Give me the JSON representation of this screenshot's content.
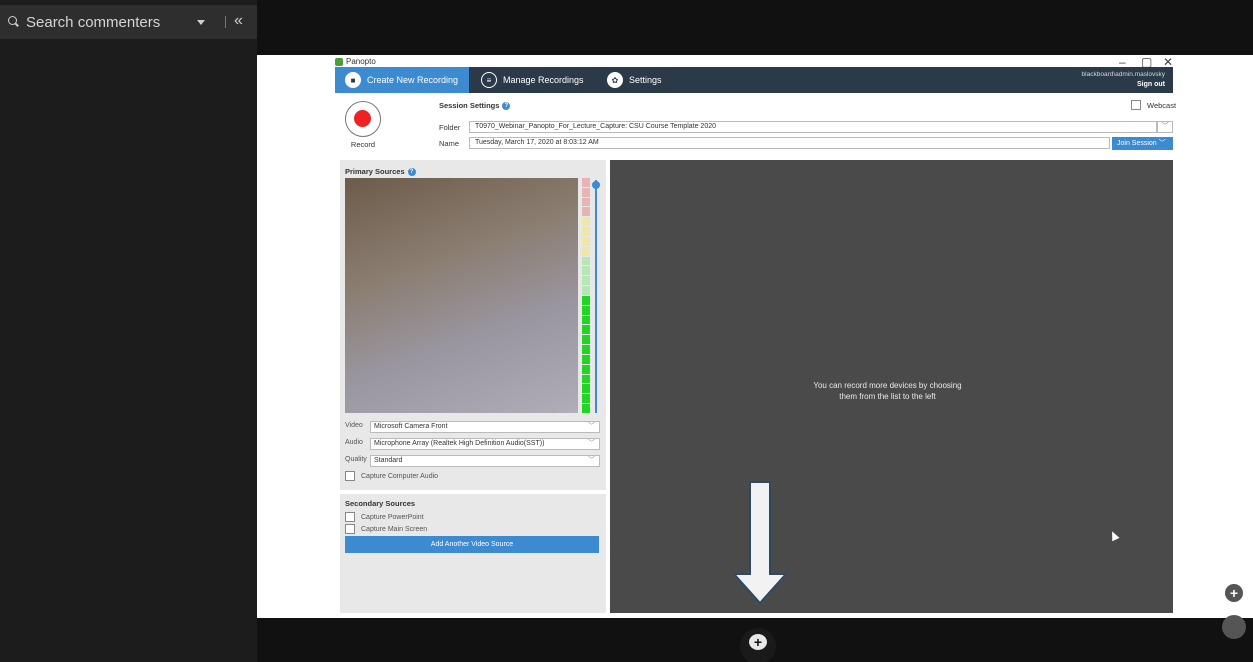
{
  "comments_panel": {
    "search_placeholder": "Search commenters",
    "collapse_symbol": "«"
  },
  "window": {
    "app_name": "Panopto",
    "controls": [
      "–",
      "▢",
      "✕"
    ]
  },
  "tabs": [
    {
      "label": "Create New Recording",
      "icon": "video-camera-icon",
      "active": true
    },
    {
      "label": "Manage Recordings",
      "icon": "list-icon",
      "active": false
    },
    {
      "label": "Settings",
      "icon": "gear-icon",
      "active": false
    }
  ],
  "user": {
    "name": "blackboard\\admin.maslovsky",
    "sign_out": "Sign out"
  },
  "record": {
    "label": "Record"
  },
  "session": {
    "title": "Session Settings",
    "help": "?",
    "webcast_label": "Webcast",
    "folder_label": "Folder",
    "folder_value": "T0970_Webinar_Panopto_For_Lecture_Capture: CSU Course Template 2020",
    "name_label": "Name",
    "name_value": "Tuesday, March 17, 2020 at 8:03:12 AM",
    "join_label": "Join Session"
  },
  "primary_sources": {
    "title": "Primary Sources",
    "help": "?",
    "video_label": "Video",
    "video_value": "Microsoft Camera Front",
    "audio_label": "Audio",
    "audio_value": "Microphone Array (Realtek High Definition Audio(SST))",
    "quality_label": "Quality",
    "quality_value": "Standard",
    "capture_audio_label": "Capture Computer Audio"
  },
  "secondary_sources": {
    "title": "Secondary Sources",
    "powerpoint_label": "Capture PowerPoint",
    "screen_label": "Capture Main Screen",
    "add_button": "Add Another Video Source"
  },
  "preview_hint": {
    "line1": "You can record more devices by choosing",
    "line2": "them from the list to the left"
  },
  "bottom": {
    "add_comment_symbol": "+",
    "zoom_in_symbol": "+"
  },
  "colors": {
    "accent": "#3c8ad0",
    "tabbar": "#2b3a48",
    "record_red": "#e22222"
  }
}
